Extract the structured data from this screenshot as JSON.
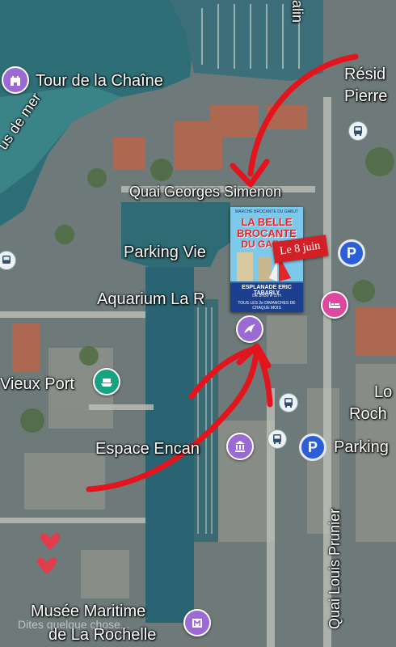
{
  "labels": {
    "tour": "Tour de la Chaîne",
    "residence_1": "Résid",
    "residence_2": "Pierre",
    "canal": "us de mer",
    "quai_simenon": "Quai Georges Simenon",
    "parking_vieux": "Parking Vie",
    "aquarium": "Aquarium La R",
    "vieux_port": "Vieux Port",
    "lo_1": "Lo",
    "lo_2": "Roch",
    "espace": "Espace Encan",
    "parking_right": "Parking",
    "quai_louis": "Quai Louis Prunier",
    "musee_1": "Musée Maritime",
    "musee_2": "de La Rochelle",
    "top_street": "alin"
  },
  "poster": {
    "small_top": "MARCHÉ BROCANTE DU GABUT",
    "line1": "LA BELLE",
    "line2": "BROCANTE",
    "line3": "DU GABUT",
    "where": "ESPLANADE ERIC TABARLY",
    "when": "DE 8H30 À 17H",
    "when2": "TOUS LES 2e DIMANCHES DE CHAQUE MOIS"
  },
  "date_tag": "Le 8 juin",
  "watermark": "Dites quelque chose...",
  "icons": {
    "tour": "castle-icon",
    "vieux_port": "ferry-icon",
    "aquarium": "dolphin-icon",
    "hotel": "hotel-bed-icon",
    "espace": "landmark-icon",
    "musee": "museum-icon",
    "bus": "bus-icon",
    "parking": "parking-icon",
    "hearts": "heart-icon"
  },
  "colors": {
    "poi_purple": "#9c6ad4",
    "poi_green": "#16a37f",
    "poi_pink": "#e0479e",
    "parking_blue": "#2b5fd9",
    "arrow_red": "#e3141c"
  }
}
